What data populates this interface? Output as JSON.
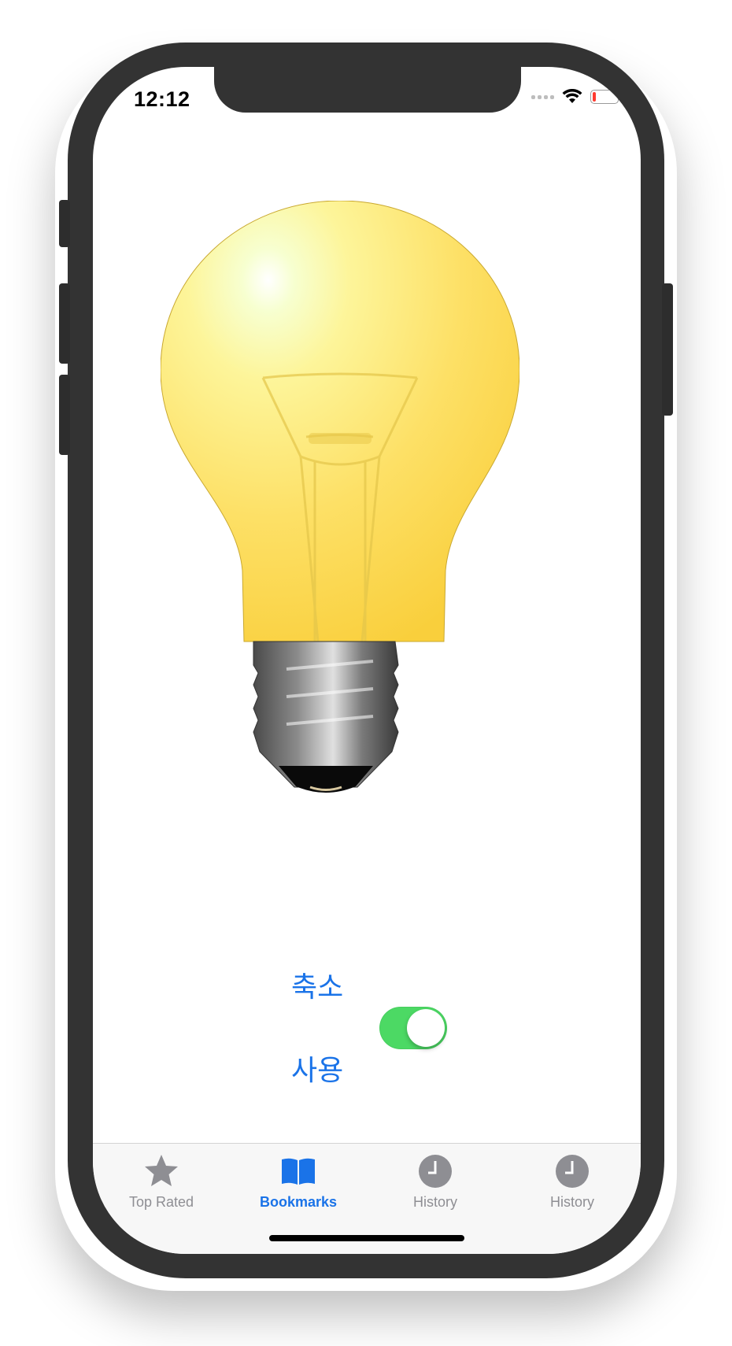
{
  "status_bar": {
    "time": "12:12"
  },
  "controls": {
    "label_top": "축소",
    "label_bottom": "사용",
    "toggle_on": true
  },
  "tab_bar": {
    "tabs": [
      {
        "label": "Top Rated",
        "icon": "star-icon",
        "active": false
      },
      {
        "label": "Bookmarks",
        "icon": "book-icon",
        "active": true
      },
      {
        "label": "History",
        "icon": "clock-icon",
        "active": false
      },
      {
        "label": "History",
        "icon": "clock-icon",
        "active": false
      }
    ]
  },
  "colors": {
    "accent": "#1a73e8",
    "toggle_on": "#4cd964",
    "tab_inactive": "#8e8e93"
  }
}
